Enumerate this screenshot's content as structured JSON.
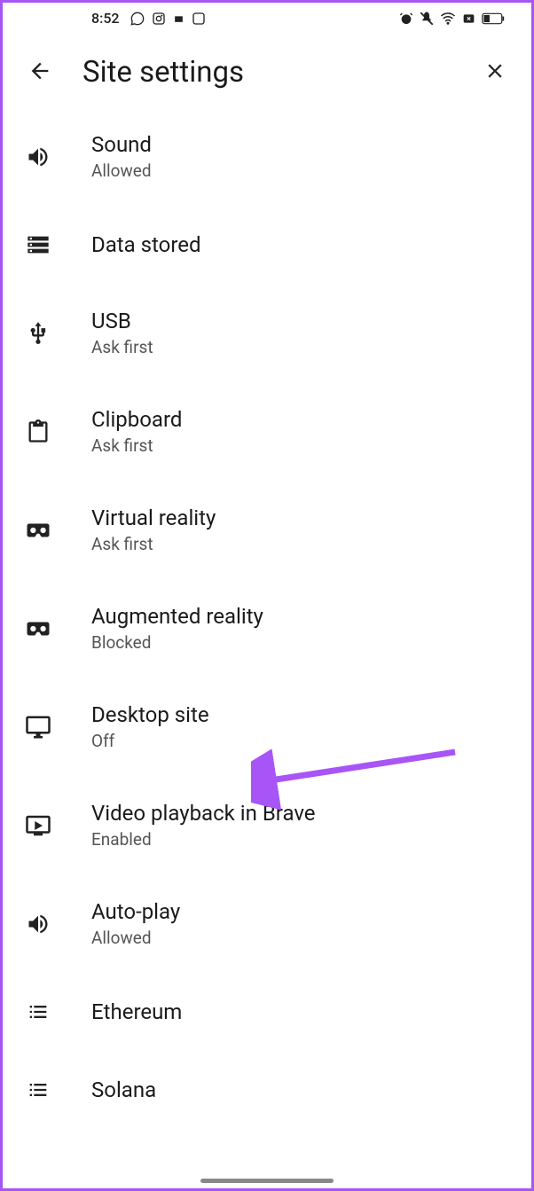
{
  "statusBar": {
    "time": "8:52"
  },
  "header": {
    "title": "Site settings"
  },
  "settings": [
    {
      "icon": "sound-icon",
      "title": "Sound",
      "subtitle": "Allowed"
    },
    {
      "icon": "storage-icon",
      "title": "Data stored",
      "subtitle": ""
    },
    {
      "icon": "usb-icon",
      "title": "USB",
      "subtitle": "Ask first"
    },
    {
      "icon": "clipboard-icon",
      "title": "Clipboard",
      "subtitle": "Ask first"
    },
    {
      "icon": "vr-icon",
      "title": "Virtual reality",
      "subtitle": "Ask first"
    },
    {
      "icon": "ar-icon",
      "title": "Augmented reality",
      "subtitle": "Blocked"
    },
    {
      "icon": "desktop-icon",
      "title": "Desktop site",
      "subtitle": "Off"
    },
    {
      "icon": "video-icon",
      "title": "Video playback in Brave",
      "subtitle": "Enabled"
    },
    {
      "icon": "autoplay-icon",
      "title": "Auto-play",
      "subtitle": "Allowed"
    },
    {
      "icon": "list-icon",
      "title": "Ethereum",
      "subtitle": ""
    },
    {
      "icon": "list-icon",
      "title": "Solana",
      "subtitle": ""
    }
  ]
}
